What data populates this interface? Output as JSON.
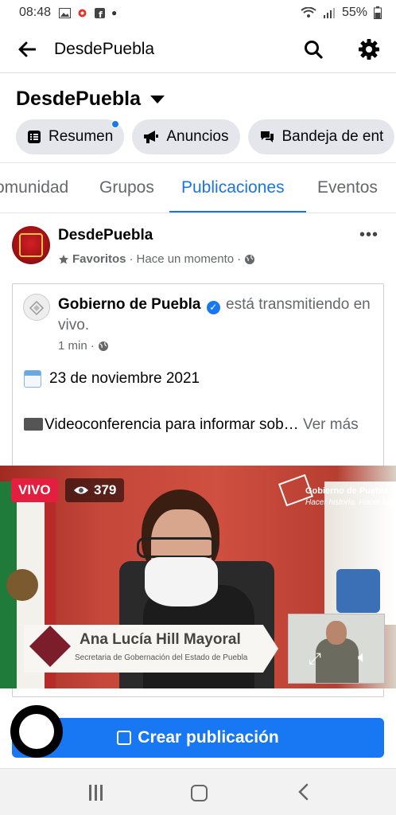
{
  "status_bar": {
    "time": "08:48",
    "battery": "55%"
  },
  "top_nav": {
    "title": "DesdePuebla"
  },
  "page_header": {
    "name": "DesdePuebla"
  },
  "chips": [
    {
      "label": "Resumen",
      "icon": "list-icon",
      "has_dot": true
    },
    {
      "label": "Anuncios",
      "icon": "megaphone-icon"
    },
    {
      "label": "Bandeja de ent",
      "icon": "chat-icon"
    }
  ],
  "tabs": [
    {
      "label": "omunidad"
    },
    {
      "label": "Grupos"
    },
    {
      "label": "Publicaciones",
      "active": true
    },
    {
      "label": "Eventos"
    }
  ],
  "post": {
    "author": "DesdePuebla",
    "favorites": "Favoritos",
    "time": "Hace un momento",
    "shared": {
      "author": "Gobierno de Puebla",
      "action": "está transmitiendo en vivo.",
      "time": "1 min",
      "date_line": "23 de noviembre 2021",
      "description": "Videoconferencia para informar sob…",
      "see_more": "Ver más"
    }
  },
  "video": {
    "live_label": "VIVO",
    "viewer_count": "379",
    "logo_title": "Gobierno de Puebla",
    "logo_tagline": "Hacer historia. Hacer futuro.",
    "speaker_name": "Ana Lucía Hill Mayoral",
    "speaker_role": "Secretaria de Gobernación del Estado de Puebla"
  },
  "create_post": {
    "label": "Crear publicación"
  },
  "colors": {
    "accent": "#1877f2",
    "live": "#e41e3f",
    "tab_active": "#1b74e4"
  }
}
